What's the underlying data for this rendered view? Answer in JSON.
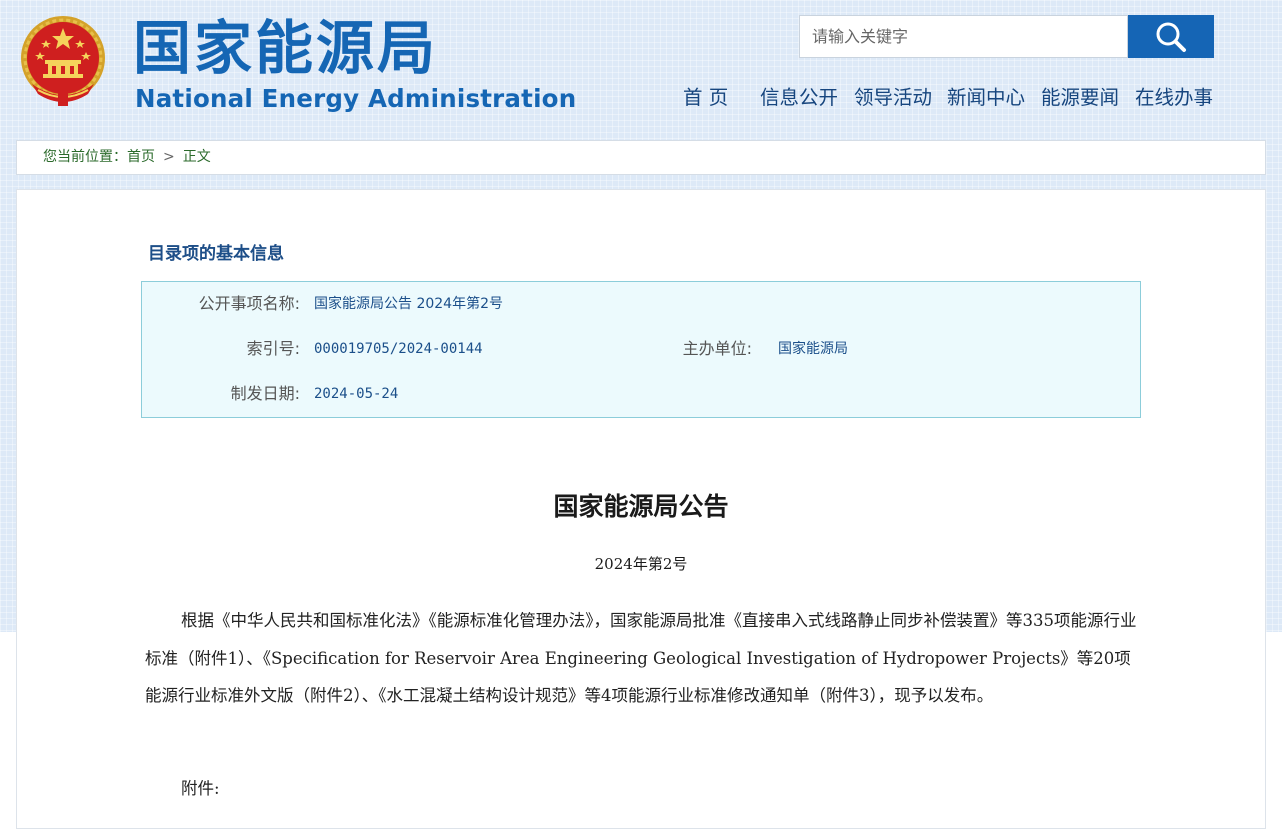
{
  "header": {
    "logo_cn": "国家能源局",
    "logo_en": "National Energy Administration",
    "emblem_icon": "national-emblem-icon"
  },
  "search": {
    "placeholder": "请输入关键字",
    "button_icon": "search-icon"
  },
  "nav": {
    "items": [
      "首 页",
      "信息公开",
      "领导活动",
      "新闻中心",
      "能源要闻",
      "在线办事"
    ]
  },
  "breadcrumb": {
    "prefix": "您当前位置：",
    "home": "首页",
    "separator": ">",
    "current": "正文"
  },
  "catalog": {
    "title": "目录项的基本信息",
    "name_label": "公开事项名称:",
    "name_value": "国家能源局公告 2024年第2号",
    "index_label": "索引号:",
    "index_value": "000019705/2024-00144",
    "org_label": "主办单位:",
    "org_value": "国家能源局",
    "date_label": "制发日期:",
    "date_value": "2024-05-24"
  },
  "document": {
    "title": "国家能源局公告",
    "number": "2024年第2号",
    "body": "根据《中华人民共和国标准化法》《能源标准化管理办法》，国家能源局批准《直接串入式线路静止同步补偿装置》等335项能源行业标准（附件1）、《Specification for Reservoir Area Engineering Geological Investigation of Hydropower Projects》等20项能源行业标准外文版（附件2）、《水工混凝土结构设计规范》等4项能源行业标准修改通知单（附件3），现予以发布。",
    "attachments_label": "附件:"
  },
  "colors": {
    "brand_blue": "#1566b4",
    "nav_text": "#16457e",
    "breadcrumb_text": "#2b6a2b",
    "info_bg": "#ecfafd",
    "info_border": "#8ccdda"
  }
}
